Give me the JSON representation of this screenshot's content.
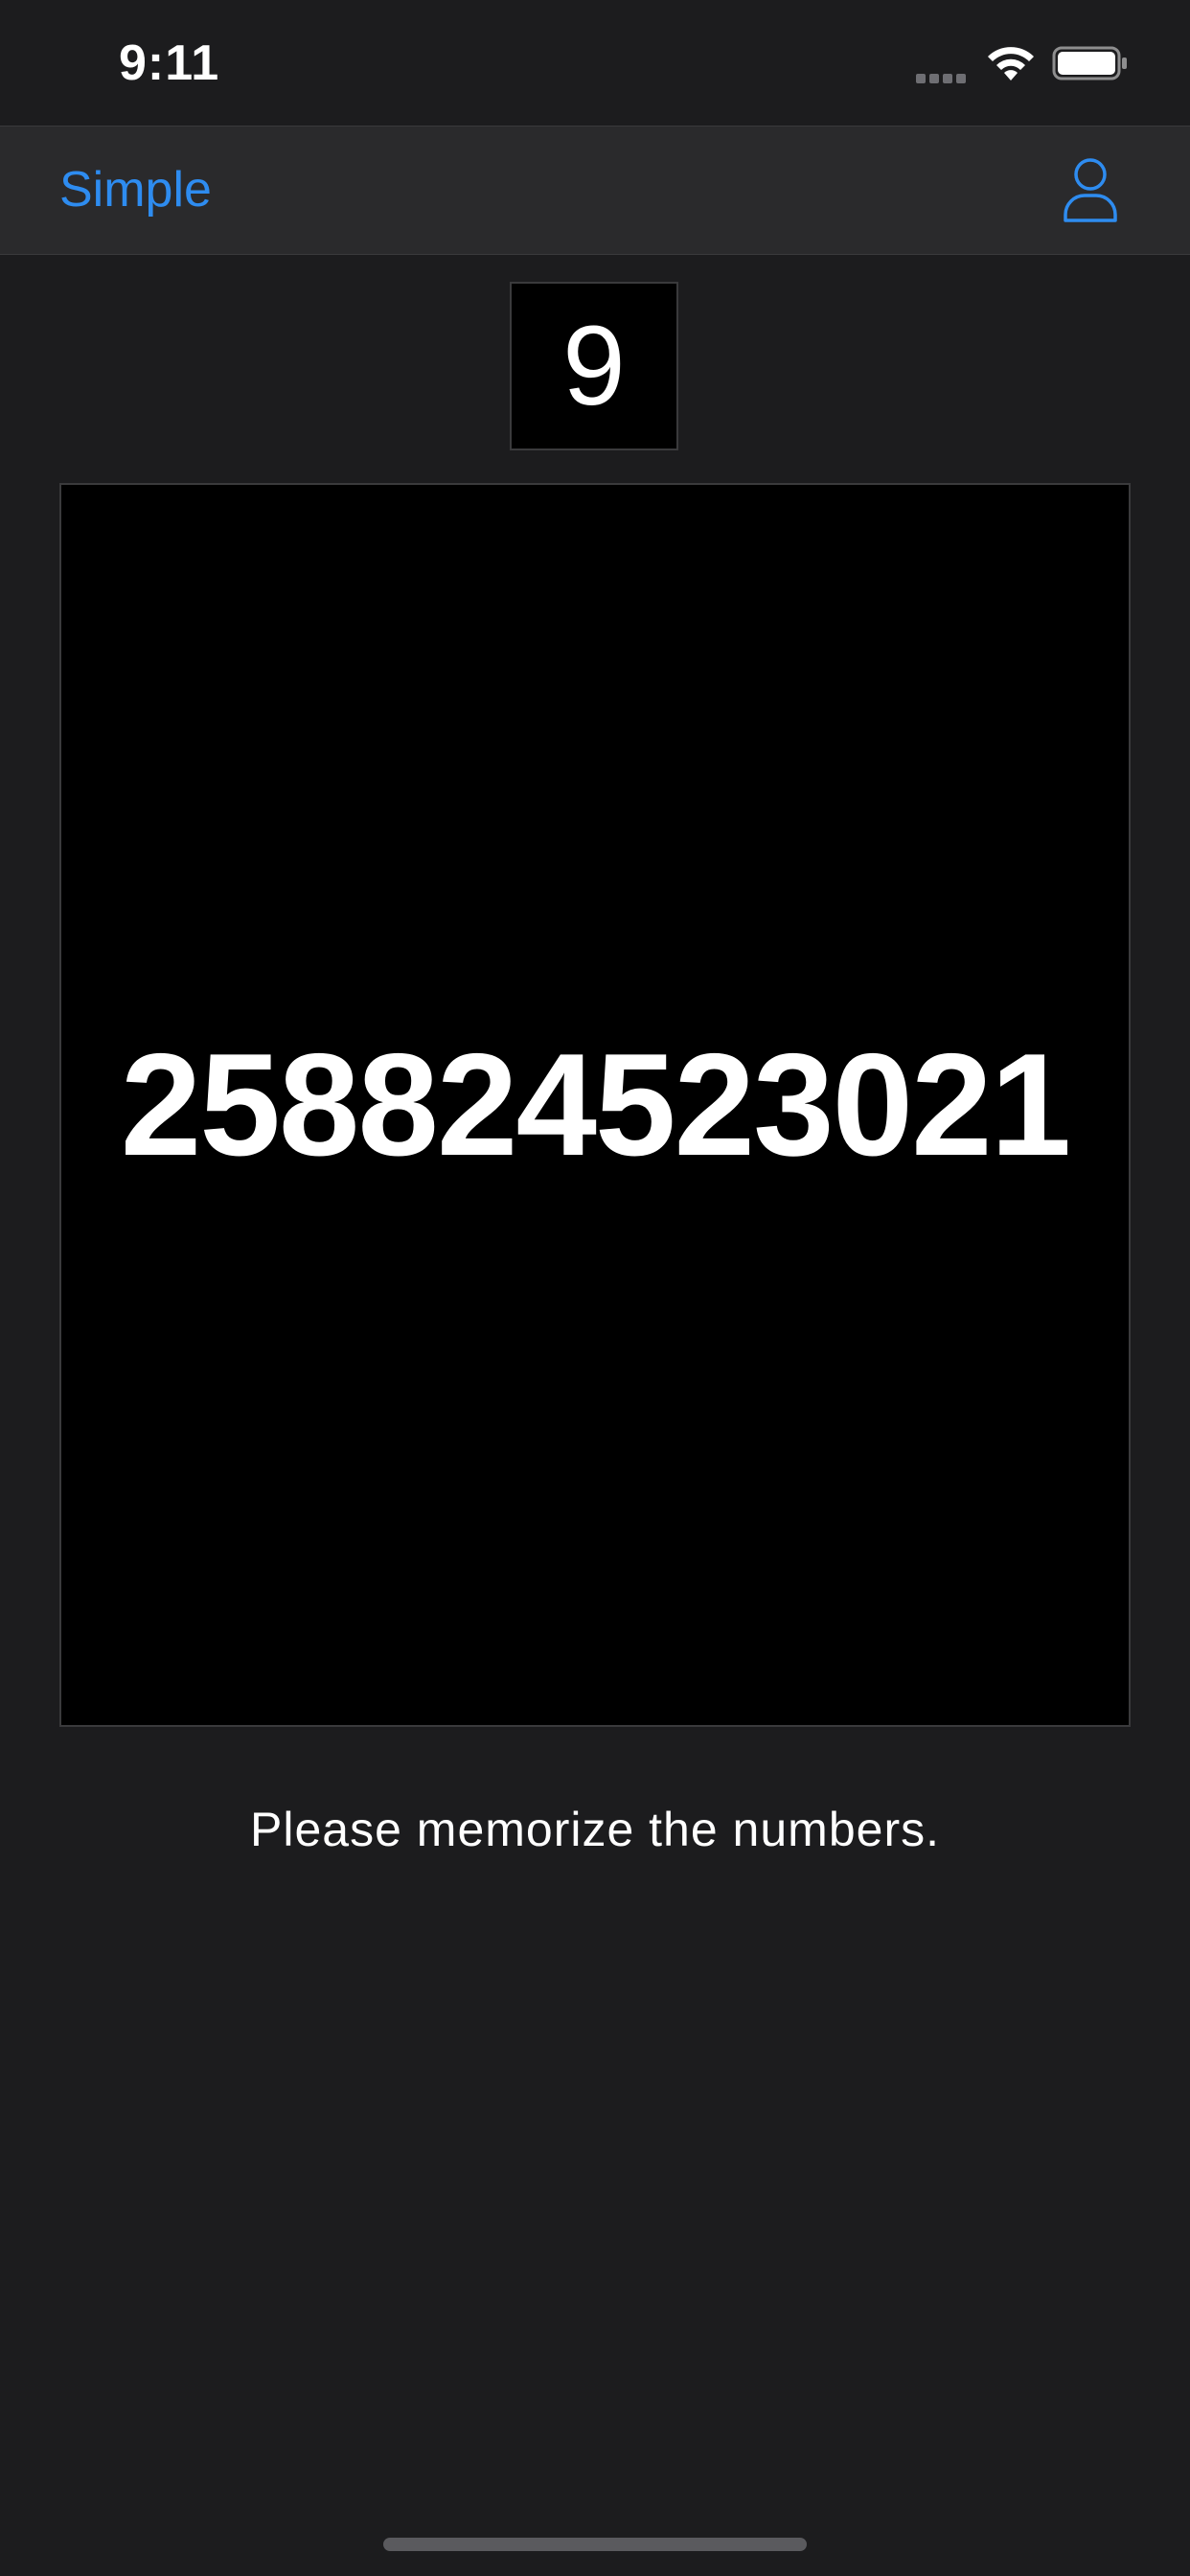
{
  "status_bar": {
    "time": "9:11"
  },
  "nav": {
    "left_label": "Simple",
    "accent_color": "#2e8cf0",
    "right_icon": "person-icon"
  },
  "counter": {
    "value": "9"
  },
  "display": {
    "number": "258824523021"
  },
  "instruction": {
    "text": "Please memorize the numbers."
  }
}
